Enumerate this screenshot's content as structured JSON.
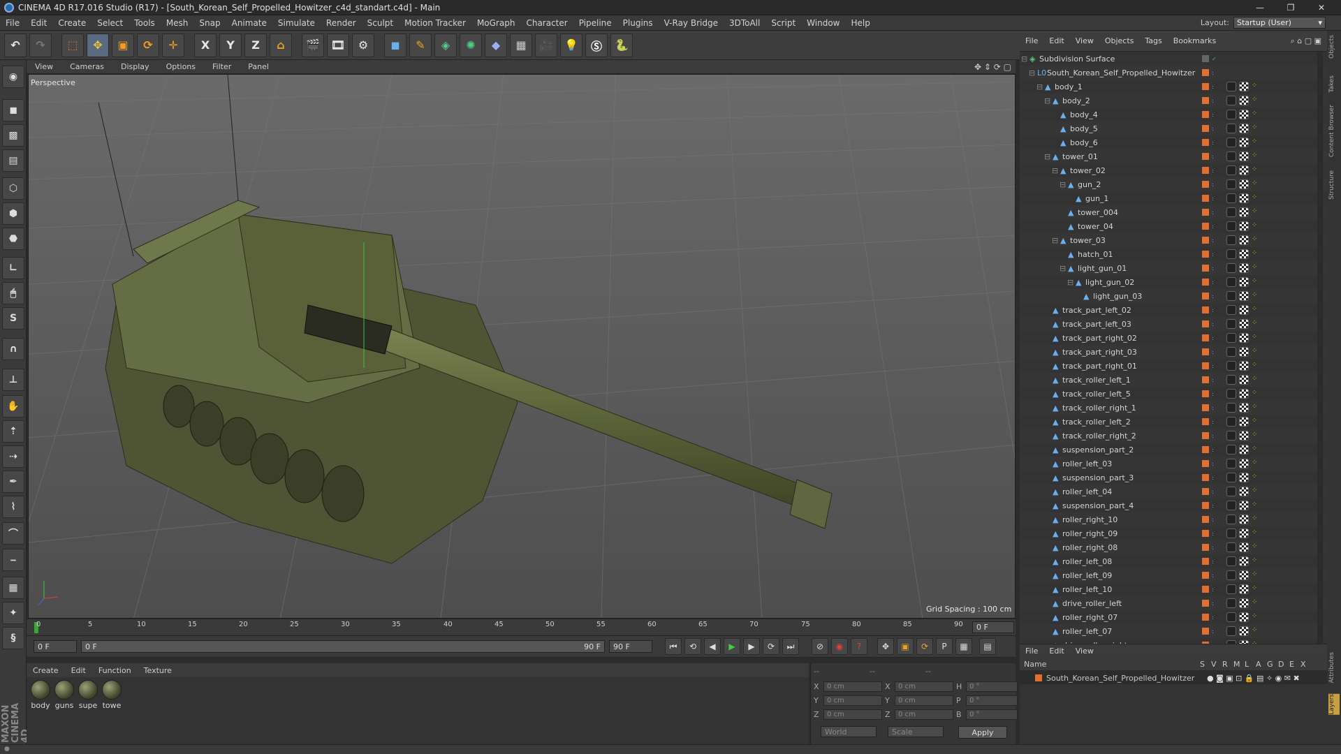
{
  "titlebar": {
    "title": "CINEMA 4D R17.016 Studio (R17) - [South_Korean_Self_Propelled_Howitzer_c4d_standart.c4d] - Main",
    "buttons": [
      "—",
      "❐",
      "✕"
    ]
  },
  "menubar": {
    "items": [
      "File",
      "Edit",
      "Create",
      "Select",
      "Tools",
      "Mesh",
      "Snap",
      "Animate",
      "Simulate",
      "Render",
      "Sculpt",
      "Motion Tracker",
      "MoGraph",
      "Character",
      "Pipeline",
      "Plugins",
      "V-Ray Bridge",
      "3DToAll",
      "Script",
      "Window",
      "Help"
    ],
    "layout_label": "Layout:",
    "layout_value": "Startup (User)"
  },
  "toolbar": {
    "buttons": [
      "undo-icon",
      "redo-icon",
      "live-select-icon",
      "move-icon",
      "scale-icon",
      "rotate-icon",
      "move-alt-icon",
      "x-axis-icon",
      "y-axis-icon",
      "z-axis-icon",
      "world-coord-icon",
      "render-view-icon",
      "render-picture-queue-icon",
      "render-settings-icon",
      "cube-icon",
      "pen-icon",
      "subdivision-icon",
      "mograph-icon",
      "deformer-icon",
      "floor-icon",
      "camera-icon",
      "light-icon",
      "vray-icon",
      "python-icon"
    ],
    "axis_labels": [
      "X",
      "Y",
      "Z"
    ]
  },
  "viewport": {
    "menu": [
      "View",
      "Cameras",
      "Display",
      "Options",
      "Filter",
      "Panel"
    ],
    "view_name": "Perspective",
    "grid_spacing": "Grid Spacing : 100 cm"
  },
  "timeline": {
    "ticks": [
      "0",
      "5",
      "10",
      "15",
      "20",
      "25",
      "30",
      "35",
      "40",
      "45",
      "50",
      "55",
      "60",
      "65",
      "70",
      "75",
      "80",
      "85",
      "90"
    ],
    "current_frame": "0 F"
  },
  "playbar": {
    "start_frame": "0 F",
    "range_start": "0 F",
    "range_end": "90 F",
    "end_frame": "90 F"
  },
  "materials": {
    "menu": [
      "Create",
      "Edit",
      "Function",
      "Texture"
    ],
    "items": [
      "body",
      "guns",
      "supe",
      "towe"
    ]
  },
  "coords": {
    "rows": [
      {
        "a": "X",
        "av": "0 cm",
        "b": "X",
        "bv": "0 cm",
        "c": "H",
        "cv": "0 °"
      },
      {
        "a": "Y",
        "av": "0 cm",
        "b": "Y",
        "bv": "0 cm",
        "c": "P",
        "cv": "0 °"
      },
      {
        "a": "Z",
        "av": "0 cm",
        "b": "Z",
        "bv": "0 cm",
        "c": "B",
        "cv": "0 °"
      }
    ],
    "header": [
      "--",
      "--",
      "--"
    ],
    "world": "World",
    "scale": "Scale",
    "apply": "Apply"
  },
  "object_manager": {
    "menu": [
      "File",
      "Edit",
      "View",
      "Objects",
      "Tags",
      "Bookmarks"
    ],
    "rows": [
      {
        "name": "Subdivision Surface",
        "depth": 0
      },
      {
        "name": "South_Korean_Self_Propelled_Howitzer",
        "depth": 1
      },
      {
        "name": "body_1",
        "depth": 2
      },
      {
        "name": "body_2",
        "depth": 3
      },
      {
        "name": "body_4",
        "depth": 4
      },
      {
        "name": "body_5",
        "depth": 4
      },
      {
        "name": "body_6",
        "depth": 4
      },
      {
        "name": "tower_01",
        "depth": 3
      },
      {
        "name": "tower_02",
        "depth": 4
      },
      {
        "name": "gun_2",
        "depth": 5
      },
      {
        "name": "gun_1",
        "depth": 6
      },
      {
        "name": "tower_004",
        "depth": 5
      },
      {
        "name": "tower_04",
        "depth": 5
      },
      {
        "name": "tower_03",
        "depth": 4
      },
      {
        "name": "hatch_01",
        "depth": 5
      },
      {
        "name": "light_gun_01",
        "depth": 5
      },
      {
        "name": "light_gun_02",
        "depth": 6
      },
      {
        "name": "light_gun_03",
        "depth": 7
      },
      {
        "name": "track_part_left_02",
        "depth": 3
      },
      {
        "name": "track_part_left_03",
        "depth": 3
      },
      {
        "name": "track_part_right_02",
        "depth": 3
      },
      {
        "name": "track_part_right_03",
        "depth": 3
      },
      {
        "name": "track_part_right_01",
        "depth": 3
      },
      {
        "name": "track_roller_left_1",
        "depth": 3
      },
      {
        "name": "track_roller_left_5",
        "depth": 3
      },
      {
        "name": "track_roller_right_1",
        "depth": 3
      },
      {
        "name": "track_roller_left_2",
        "depth": 3
      },
      {
        "name": "track_roller_right_2",
        "depth": 3
      },
      {
        "name": "suspension_part_2",
        "depth": 3
      },
      {
        "name": "roller_left_03",
        "depth": 3
      },
      {
        "name": "suspension_part_3",
        "depth": 3
      },
      {
        "name": "roller_left_04",
        "depth": 3
      },
      {
        "name": "suspension_part_4",
        "depth": 3
      },
      {
        "name": "roller_right_10",
        "depth": 3
      },
      {
        "name": "roller_right_09",
        "depth": 3
      },
      {
        "name": "roller_right_08",
        "depth": 3
      },
      {
        "name": "roller_left_08",
        "depth": 3
      },
      {
        "name": "roller_left_09",
        "depth": 3
      },
      {
        "name": "roller_left_10",
        "depth": 3
      },
      {
        "name": "drive_roller_left",
        "depth": 3
      },
      {
        "name": "roller_right_07",
        "depth": 3
      },
      {
        "name": "roller_left_07",
        "depth": 3
      },
      {
        "name": "drive_roller_right",
        "depth": 3
      }
    ]
  },
  "layer_manager": {
    "menu": [
      "File",
      "Edit",
      "View"
    ],
    "header_name": "Name",
    "header_cols": [
      "S",
      "V",
      "R",
      "M",
      "L",
      "A",
      "G",
      "D",
      "E",
      "X"
    ],
    "layer": "South_Korean_Self_Propelled_Howitzer"
  },
  "side_tabs": [
    "Objects",
    "Takes",
    "Content Browser",
    "Structure",
    "Attributes",
    "Layers"
  ],
  "branding": "MAXON CINEMA 4D",
  "colors": {
    "orange": "#e07030",
    "accent_blue": "#4a90d9",
    "viewport_bg": "#5a5a5a",
    "model_green": "#5f6640"
  }
}
